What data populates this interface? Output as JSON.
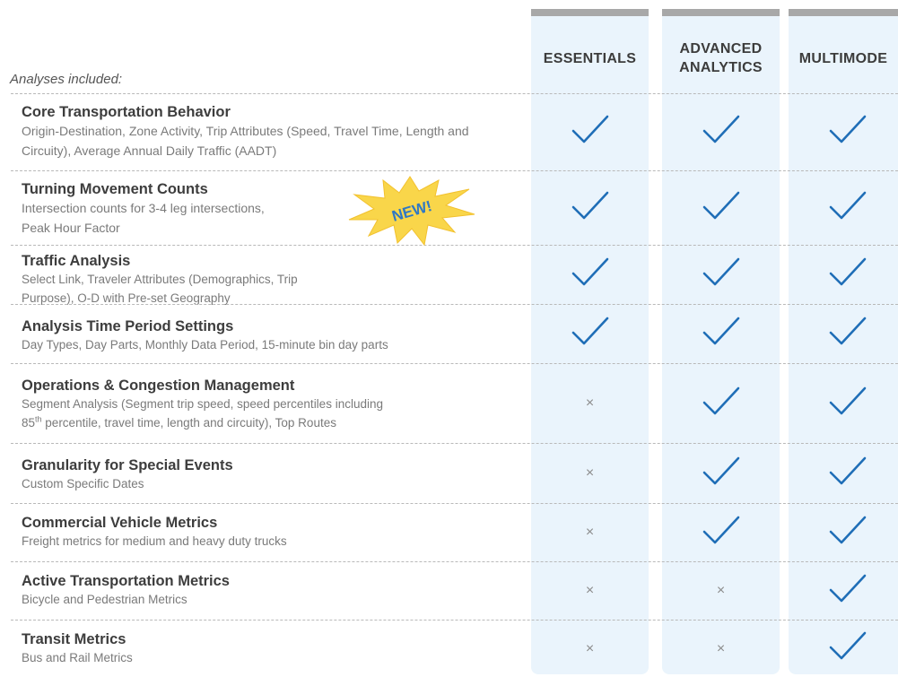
{
  "plans": [
    {
      "name": "ESSENTIALS"
    },
    {
      "name": "ADVANCED ANALYTICS"
    },
    {
      "name": "MULTIMODE"
    }
  ],
  "analyses_label": "Analyses included:",
  "badge": "NEW!",
  "colors": {
    "check": "#1f6eb7",
    "column_bg": "#eaf4fc",
    "column_top": "#a8a8a8",
    "burst": "#f9d64a"
  },
  "rows": [
    {
      "title": "Core Transportation Behavior",
      "desc": "Origin-Destination, Zone Activity, Trip Attributes (Speed, Travel Time, Length and Circuity), Average Annual Daily Traffic (AADT)",
      "essentials": true,
      "advanced": true,
      "multimode": true
    },
    {
      "title": "Turning Movement Counts",
      "desc1": "Intersection counts for 3-4 leg intersections,",
      "desc2": "Peak Hour Factor",
      "essentials": true,
      "advanced": true,
      "multimode": true
    },
    {
      "title": "Traffic Analysis",
      "desc1": "Select Link, Traveler Attributes (Demographics, Trip",
      "desc2": "Purpose), O-D with Pre-set Geography",
      "essentials": true,
      "advanced": true,
      "multimode": true
    },
    {
      "title": "Analysis Time Period Settings",
      "desc": "Day Types, Day Parts, Monthly Data Period, 15-minute bin day parts",
      "essentials": true,
      "advanced": true,
      "multimode": true
    },
    {
      "title": "Operations & Congestion Management",
      "desc1": "Segment Analysis (Segment trip speed, speed percentiles including",
      "desc2_num": "85",
      "desc2_sup": "th",
      "desc2_rest": " percentile, travel time, length and circuity), Top Routes",
      "essentials": false,
      "advanced": true,
      "multimode": true
    },
    {
      "title": "Granularity for Special Events",
      "desc": "Custom Specific Dates",
      "essentials": false,
      "advanced": true,
      "multimode": true
    },
    {
      "title": "Commercial Vehicle Metrics",
      "desc": "Freight metrics for medium and heavy duty trucks",
      "essentials": false,
      "advanced": true,
      "multimode": true
    },
    {
      "title": "Active Transportation Metrics",
      "desc": "Bicycle and Pedestrian Metrics",
      "essentials": false,
      "advanced": false,
      "multimode": true
    },
    {
      "title": "Transit Metrics",
      "desc": "Bus and Rail Metrics",
      "essentials": false,
      "advanced": false,
      "multimode": true
    }
  ]
}
